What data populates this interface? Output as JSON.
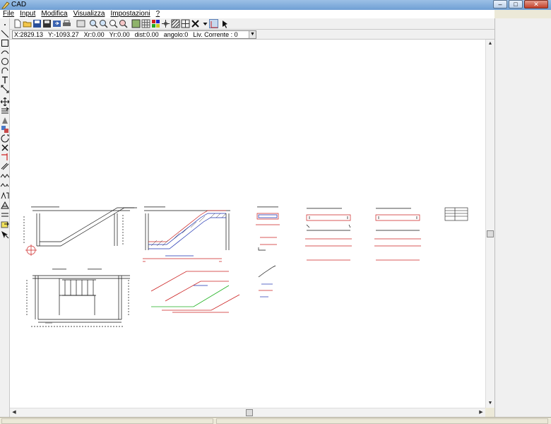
{
  "window": {
    "title": "CAD",
    "minimize": "–",
    "maximize": "□",
    "close": "✕"
  },
  "menu": [
    "File",
    "Input",
    "Modifica",
    "Visualizza",
    "Impostazioni",
    "?"
  ],
  "toolbar_icons": [
    "new-file-icon",
    "open-folder-icon",
    "save-icon",
    "save-as-icon",
    "export-icon",
    "print-icon",
    "preview-icon",
    "zoom-in-icon",
    "zoom-out-icon",
    "zoom-window-icon",
    "zoom-all-icon",
    "layers-icon",
    "grid-icon",
    "color-icon",
    "snap-icon",
    "hatch-icon",
    "table-icon",
    "delete-icon",
    "dropdown-arrow-icon",
    "ortho-icon",
    "select-arrow-icon"
  ],
  "left_tools": [
    "point-icon",
    "line-icon",
    "rectangle-icon",
    "arc-icon",
    "circle-icon",
    "arc2-icon",
    "text-icon",
    "dimension-icon",
    "move-icon",
    "copy-icon",
    "mirror-icon",
    "rotate-icon",
    "scale-icon",
    "erase-icon",
    "trim-icon",
    "extend-icon",
    "offset-icon",
    "measure-icon",
    "hatch-tool-icon",
    "array-icon",
    "block-icon",
    "insert-icon"
  ],
  "coords": {
    "x": "X:2829.13",
    "y": "Y:-1093.27",
    "xr": "Xr:0.00",
    "yr": "Yr:0.00",
    "dist": "dist:0.00",
    "angolo": "angolo:0",
    "liv": "Liv. Corrente : 0"
  },
  "scroll": {
    "up": "▲",
    "down": "▼",
    "left": "◀",
    "right": "▶",
    "dd": "▼"
  }
}
